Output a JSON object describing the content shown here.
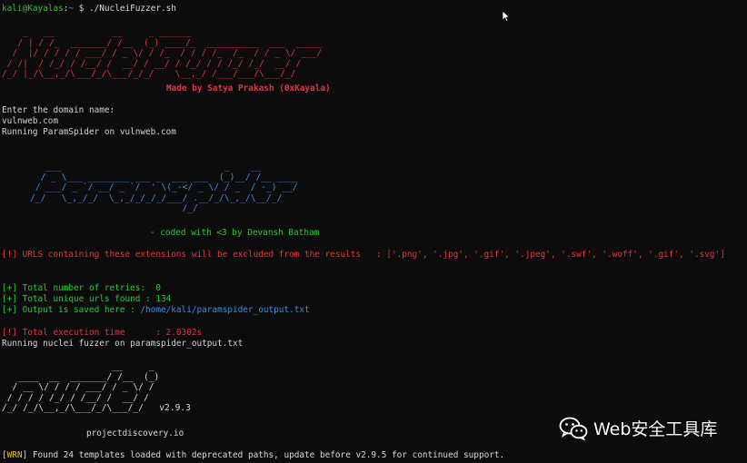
{
  "terminal": {
    "prompt_user": "kali@Kayalas",
    "prompt_sep": ":",
    "prompt_path": "~",
    "prompt_symbol": " $ ",
    "command": "./NucleiFuzzer.sh",
    "banner_nucleifuzzer": "    _   __           __     _ ______\n   / | / /_  _______/ /__  (_) ____/_  __________  ___  _____\n  /  |/ / / / / ___/ / _ \\/ / /_  / / / /_  /_  / / _ \\/ ___/\n / /|  / /_/ / /__/ /  __/ / __/ / /_/ / / /_/ /_/  __/ /\n/_/ |_/\\__,_/\\___/_/\\___/_/_/    \\__,_/ /___/___/\\___/_/",
    "made_by": "Made by Satya Prakash (0xKayala)",
    "enter_domain": "Enter the domain name:",
    "domain": "vulnweb.com",
    "running_paramspider": "Running ParamSpider on vulnweb.com",
    "banner_paramspider": "       ___                               _    __\n      / _ \\___ ________ ___ _  ___ ___  (_)__/ /__ ____\n     / ___/ _ `/ __/ _ `/  ' \\(_-</ _ \\/ / _  / -_) __/\n    /_/   \\_,_/_/  \\_,_/_/_/_/___/ .__/_/\\_,_/\\__/_/\n                                 /_/",
    "coded_with": "- coded with <3 by Devansh Batham",
    "excluded_line": "[!] URLS containing these extensions will be excluded from the results   : ['.png', '.jpg', '.gif', '.jpeg', '.swf', '.woff', '.gif', '.svg']",
    "retries": "[+] Total number of retries:  0",
    "unique_urls": "[+] Total unique urls found : 134",
    "output_saved_prefix": "[+] Output is saved here : ",
    "output_saved_path": "/home/kali/paramspider_output.txt",
    "exec_time": "[!] Total execution time      : 2.0302s",
    "running_nuclei": "Running nuclei fuzzer on paramspider_output.txt",
    "banner_nuclei": "                     __     _\n   ____  __  _______/ /__  (_)\n  / __ \\/ / / / ___/ / _ \\/ /\n / / / / /_/ / /__/ /  __/ /\n/_/ /_/\\__,_/\\___/_/\\___/_/   v2.9.3",
    "projectdiscovery": "projectdiscovery.io",
    "warn_tag": "WRN",
    "warn_text": " Found 24 templates loaded with deprecated paths, update before v2.9.5 for continued support."
  },
  "watermark": {
    "text": "Web安全工具库",
    "icon": "wechat-icon"
  },
  "colors": {
    "background": "#0c0c0c",
    "red": "#e5343f",
    "green": "#28c93a",
    "blue": "#3b8eea",
    "yellow": "#e5c000"
  }
}
